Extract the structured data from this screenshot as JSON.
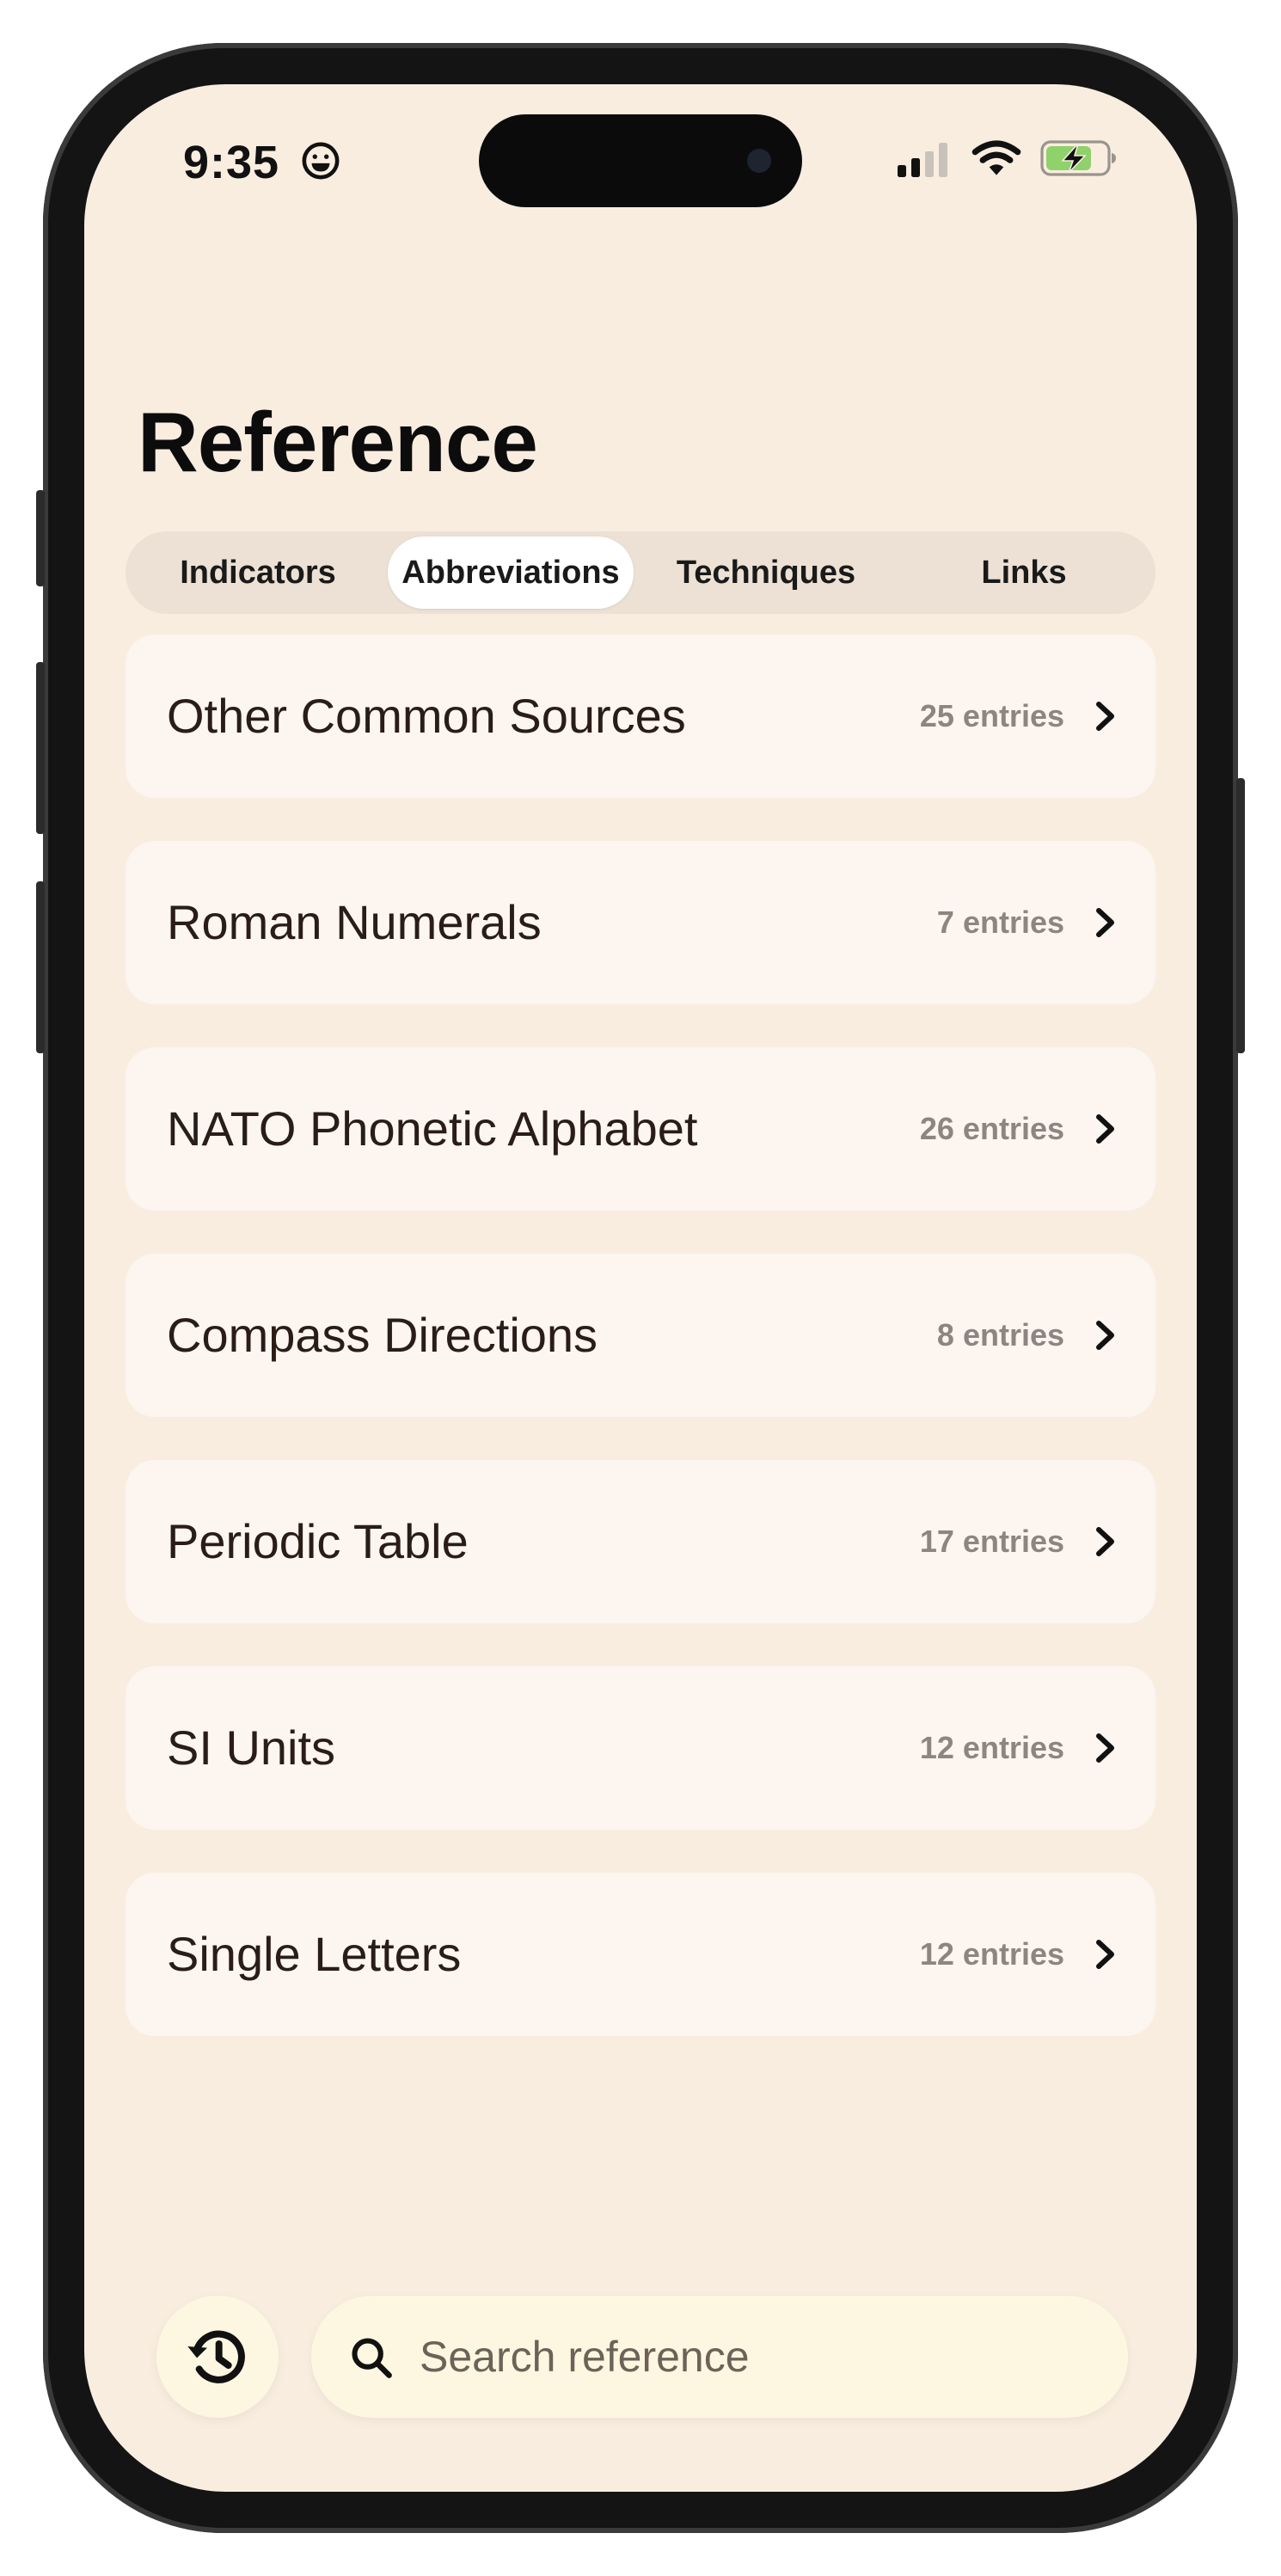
{
  "status_bar": {
    "time": "9:35"
  },
  "header": {
    "title": "Reference"
  },
  "tabs": [
    {
      "label": "Indicators",
      "active": false
    },
    {
      "label": "Abbreviations",
      "active": true
    },
    {
      "label": "Techniques",
      "active": false
    },
    {
      "label": "Links",
      "active": false
    }
  ],
  "categories": [
    {
      "title": "Other Common Sources",
      "count": "25 entries"
    },
    {
      "title": "Roman Numerals",
      "count": "7 entries"
    },
    {
      "title": "NATO Phonetic Alphabet",
      "count": "26 entries"
    },
    {
      "title": "Compass Directions",
      "count": "8 entries"
    },
    {
      "title": "Periodic Table",
      "count": "17 entries"
    },
    {
      "title": "SI Units",
      "count": "12 entries"
    },
    {
      "title": "Single Letters",
      "count": "12 entries"
    }
  ],
  "search": {
    "placeholder": "Search reference"
  },
  "icons": {
    "status": [
      "smiley-icon",
      "signal-icon",
      "wifi-icon",
      "battery-charging-icon"
    ],
    "list": "chevron-right-icon",
    "history": "history-icon",
    "search": "search-icon"
  },
  "colors": {
    "background": "#f9ede0",
    "card": "#fcf5f0",
    "segmented_track": "#ece1d4",
    "active_tab": "#ffffff",
    "title_text": "#2a1c16",
    "count_text": "#8e8580",
    "search_field": "#fdf7e1",
    "battery_fill": "#8fd16a"
  }
}
